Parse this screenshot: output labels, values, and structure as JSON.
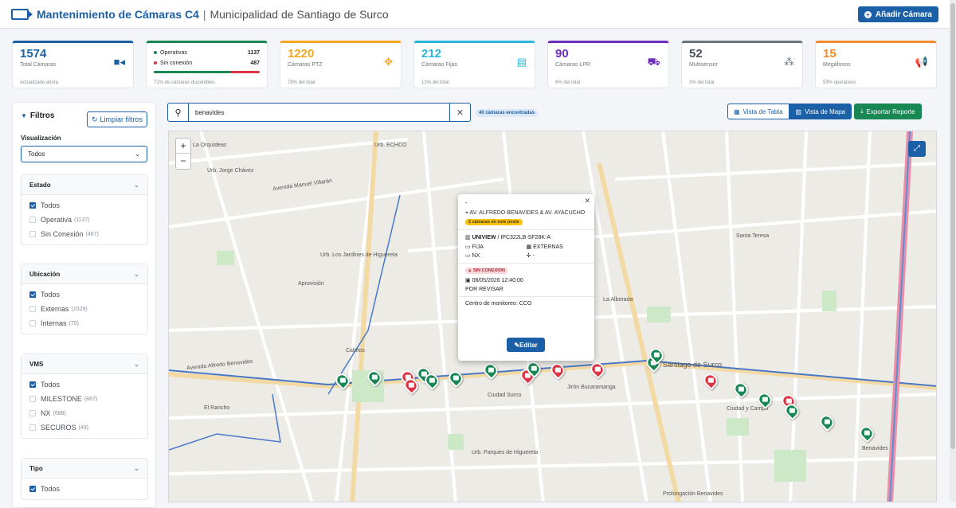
{
  "header": {
    "title": "Mantenimiento de Cámaras C4",
    "separator": "|",
    "subtitle": "Municipalidad de Santiago de Surco",
    "add_label": "Añadir Cámara"
  },
  "stats": [
    {
      "value": "1574",
      "label": "Total Cámaras",
      "foot": "Actualizado ahora",
      "color": "#1b5fa6"
    },
    {
      "op_label": "Operativas",
      "op_value": "1137",
      "off_label": "Sin conexión",
      "off_value": "487",
      "progress": 0.72,
      "foot": "72% de cámaras disponibles",
      "color": "#198754"
    },
    {
      "value": "1220",
      "label": "Cámaras PTZ",
      "foot": "78% del total",
      "color": "#f5a623"
    },
    {
      "value": "212",
      "label": "Cámaras Fijas",
      "foot": "13% del total",
      "color": "#2bb5d9"
    },
    {
      "value": "90",
      "label": "Cámaras LPR",
      "foot": "6% del total",
      "color": "#6f2dbd"
    },
    {
      "value": "52",
      "label": "Multisensor",
      "foot": "3% del total",
      "color": "#6c757d"
    },
    {
      "value": "15",
      "label": "Megáfonos",
      "foot": "53% operativos",
      "color": "#f08c2e"
    }
  ],
  "filters": {
    "title": "Filtros",
    "clear_label": "Limpiar filtros",
    "vis_label": "Visualización",
    "vis_value": "Todos",
    "groups": [
      {
        "title": "Estado",
        "options": [
          {
            "label": "Todos",
            "count": ""
          },
          {
            "label": "Operativa",
            "count": "(1137)"
          },
          {
            "label": "Sin Conexión",
            "count": "(487)"
          }
        ]
      },
      {
        "title": "Ubicación",
        "options": [
          {
            "label": "Todos",
            "count": ""
          },
          {
            "label": "Externas",
            "count": "(1529)"
          },
          {
            "label": "Internas",
            "count": "(75)"
          }
        ]
      },
      {
        "title": "VMS",
        "options": [
          {
            "label": "Todos",
            "count": ""
          },
          {
            "label": "MILESTONE",
            "count": "(887)"
          },
          {
            "label": "NX",
            "count": "(688)"
          },
          {
            "label": "SECUROS",
            "count": "(49)"
          }
        ]
      },
      {
        "title": "Tipo",
        "options": [
          {
            "label": "Todos",
            "count": ""
          }
        ]
      }
    ]
  },
  "search": {
    "value": "benavides",
    "found": "40 cámaras encontradas"
  },
  "views": {
    "table": "Vista de Tabla",
    "map": "Vista de Mapa",
    "export": "Exportar Reporte"
  },
  "map_labels": [
    "La Orquídeas",
    "Urb. ECHCO",
    "Urb. Jorge Chávez",
    "Avenida Manuel Villarán",
    "Aprovisión",
    "Urb. Los Jardines de Higuereta",
    "Avenida Alfredo Benavides",
    "Cabitos",
    "Ciudad Surco",
    "Jirón Bucaramanga",
    "La Alborada",
    "Santiago de Surco",
    "Santa Teresa",
    "El Rancho",
    "Prolongación Benavides",
    "Benavides",
    "Urb. Parques de Higuereta",
    "Ciudad y Campo"
  ],
  "popup": {
    "dash": "-",
    "address": "AV. ALFREDO BENAVIDES & AV. AYACUCHO",
    "badge": "2 cámaras en este poste",
    "brand": "UNIVIEW",
    "model": "/ IPC322LB-SF28K-A",
    "type": "FIJA",
    "location": "EXTERNAS",
    "vms": "NX",
    "extra": "-",
    "status": "SIN CONEXION",
    "datetime": "08/05/2026 12:40:00",
    "review": "POR REVISAR",
    "monitor": "Centro de monitoreo: CCO",
    "edit_label": "Editar"
  }
}
